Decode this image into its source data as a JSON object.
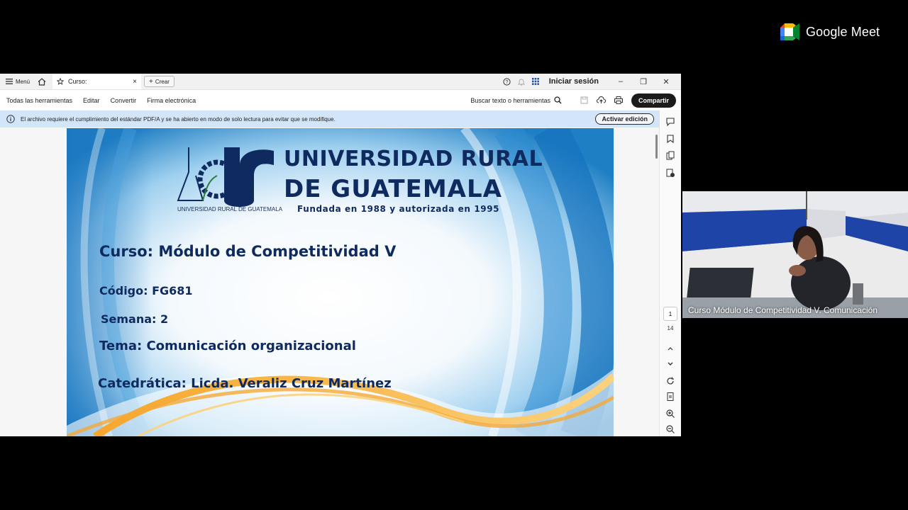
{
  "meet": {
    "brand": "Google Meet",
    "participant_name": "Curso Módulo de Competitividad V. Comunicación"
  },
  "viewer": {
    "menu_label": "Menú",
    "tab_title": "Curso:",
    "new_label": "Crear",
    "signin_label": "Iniciar sesión",
    "toolbar": {
      "all_tools": "Todas las herramientas",
      "edit": "Editar",
      "convert": "Convertir",
      "esign": "Firma electrónica",
      "search": "Buscar texto o herramientas",
      "share": "Compartir"
    },
    "info_message": "El archivo requiere el cumplimiento del estándar PDF/A y se ha abierto en modo de solo lectura para evitar que se modifique.",
    "activate_label": "Activar edición",
    "current_page": "1",
    "total_pages": "14"
  },
  "slide": {
    "university_line1": "UNIVERSIDAD RURAL",
    "university_line2": "DE GUATEMALA",
    "founded": "Fundada en 1988 y autorizada en 1995",
    "logo_caption": "UNIVERSIDAD RURAL DE GUATEMALA",
    "course": "Curso: Módulo de Competitividad V",
    "code": "Código: FG681",
    "week": "Semana: 2",
    "topic": "Tema: Comunicación organizacional",
    "teacher": "Catedrática: Licda. Veraliz Cruz Martínez"
  },
  "colors": {
    "slide_text": "#0f2a5e",
    "info_bar": "#d3e5f8",
    "share_button": "#1b1b1b"
  }
}
